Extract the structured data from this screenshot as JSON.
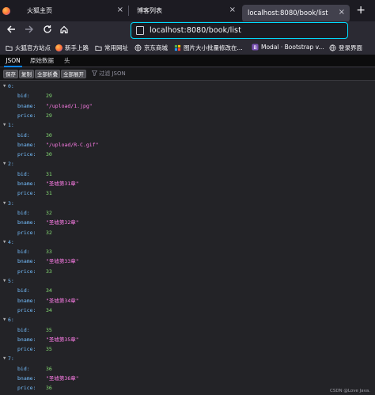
{
  "browser": {
    "tabs": [
      {
        "title": "火狐主页",
        "active": false
      },
      {
        "title": "博客列表",
        "active": false
      },
      {
        "title": "localhost:8080/book/list",
        "active": true
      }
    ],
    "new_tab_glyph": "+",
    "close_glyph": "×",
    "url": "localhost:8080/book/list",
    "nav_icons": [
      "back-arrow-icon",
      "forward-arrow-icon",
      "reload-icon",
      "home-icon"
    ],
    "accent_color": "#00ddff"
  },
  "bookmarks": [
    {
      "label": "火狐官方站点",
      "icon": "folder-icon"
    },
    {
      "label": "新手上路",
      "icon": "firefox-icon"
    },
    {
      "label": "常用网址",
      "icon": "folder-icon"
    },
    {
      "label": "京东商城",
      "icon": "globe-icon"
    },
    {
      "label": "图片大小批量修改在...",
      "icon": "app-grid-icon"
    },
    {
      "label": "Modal · Bootstrap v...",
      "icon": "bootstrap-icon"
    },
    {
      "label": "登录界面",
      "icon": "globe-icon"
    }
  ],
  "viewer_tabs": [
    "JSON",
    "原始数据",
    "头"
  ],
  "toolbar": {
    "save": "保存",
    "copy": "复制",
    "collapse_all": "全部折叠",
    "expand_all": "全部展开",
    "filter_placeholder": "过滤 JSON"
  },
  "records": [
    {
      "index": "0:",
      "bid": "29",
      "bname": "\"/upload/1.jpg\"",
      "price": "29"
    },
    {
      "index": "1:",
      "bid": "30",
      "bname": "\"/upload/R-C.gif\"",
      "price": "30"
    },
    {
      "index": "2:",
      "bid": "31",
      "bname": "\"圣墟第31章\"",
      "price": "31"
    },
    {
      "index": "3:",
      "bid": "32",
      "bname": "\"圣墟第32章\"",
      "price": "32"
    },
    {
      "index": "4:",
      "bid": "33",
      "bname": "\"圣墟第33章\"",
      "price": "33"
    },
    {
      "index": "5:",
      "bid": "34",
      "bname": "\"圣墟第34章\"",
      "price": "34"
    },
    {
      "index": "6:",
      "bid": "35",
      "bname": "\"圣墟第35章\"",
      "price": "35"
    },
    {
      "index": "7:",
      "bid": "36",
      "bname": "\"圣墟第36章\"",
      "price": "36"
    }
  ],
  "keys": {
    "bid": "bid:",
    "bname": "bname:",
    "price": "price:"
  },
  "twisty": "▼",
  "colors": {
    "key": "#75bfff",
    "number": "#86de74",
    "string": "#ff7de9"
  },
  "watermark": "CSDN @Love Java."
}
